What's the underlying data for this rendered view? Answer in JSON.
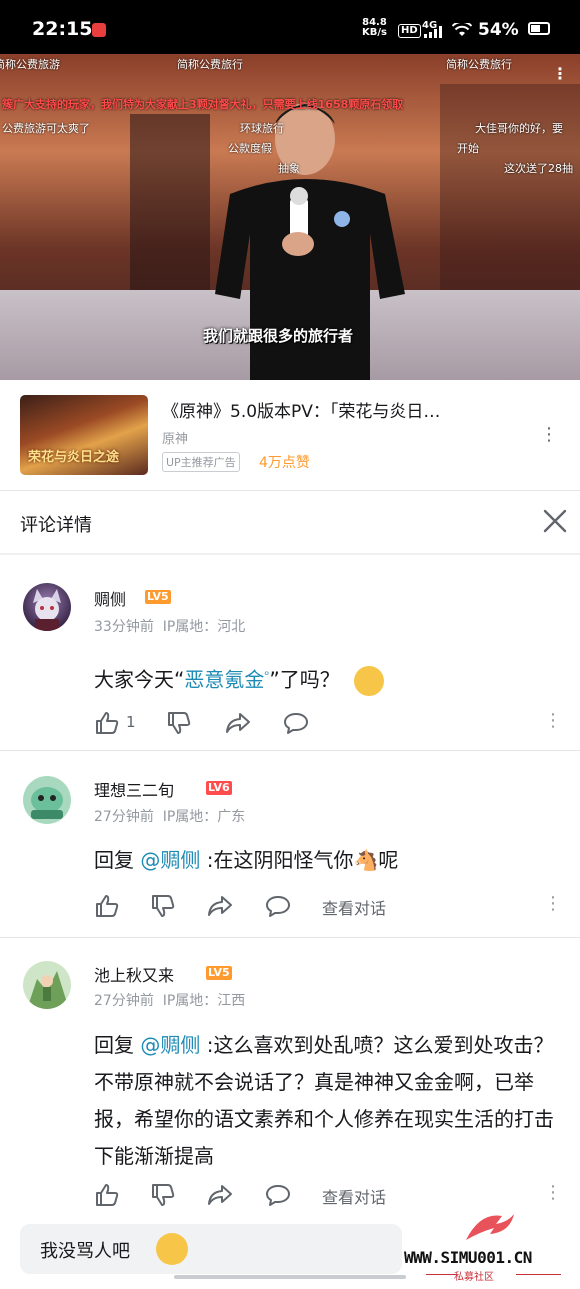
{
  "status_bar": {
    "time": "22:15",
    "net_speed": "84.8",
    "net_unit": "KB/s",
    "hd": "HD",
    "network": "4G",
    "battery": "54%"
  },
  "video": {
    "subtitle": "我们就跟很多的旅行者",
    "danmaku": [
      "简称公费旅游",
      "简称公费旅行",
      "简称公费旅行",
      "簇广大支持的玩家，我们特为大家献上3颗对督大礼，只需要上线1658颗原石领取",
      "公费旅游可太爽了",
      "环球旅行",
      "大佳哥你的好，要",
      "公款度假",
      "开始",
      "抽象",
      "这次送了28抽"
    ]
  },
  "video_card": {
    "thumb_caption": "荣花与炎日之途",
    "title": "《原神》5.0版本PV：「荣花与炎日…",
    "author": "原神",
    "ad_tag": "UP主推荐广告",
    "likes": "4万点赞"
  },
  "comments_panel": {
    "title": "评论详情"
  },
  "comments": [
    {
      "username": "赒侧",
      "level": "LV5",
      "time": "33分钟前",
      "location": "IP属地：河北",
      "text_before": "大家今天“",
      "keyword": "恶意氪金",
      "text_after": "”了吗？",
      "like_count": "1"
    },
    {
      "username": "理想三二旬",
      "level": "LV6",
      "time": "27分钟前",
      "location": "IP属地：广东",
      "reply_prefix": "回复 ",
      "mention": "@赒侧",
      "text": " :在这阴阳怪气你🐴呢",
      "view_conversation": "查看对话"
    },
    {
      "username": "池上秋又来",
      "level": "LV5",
      "time": "27分钟前",
      "location": "IP属地：江西",
      "reply_prefix": "回复 ",
      "mention": "@赒侧",
      "text": " :这么喜欢到处乱喷？这么爱到处攻击？不带原神就不会说话了？真是神神又金金啊，已举报，希望你的语文素养和个人修养在现实生活的打击下能渐渐提高",
      "view_conversation": "查看对话"
    }
  ],
  "reply_bar": {
    "text": "我没骂人吧"
  },
  "watermark": {
    "text": "WWW.SIMU001.CN",
    "sub": "私募社区"
  },
  "colors": {
    "accent_link": "#1e8bb5",
    "lv5": "#ff9a2e",
    "lv6": "#ff4d4d",
    "likes": "#ff9a2e"
  }
}
